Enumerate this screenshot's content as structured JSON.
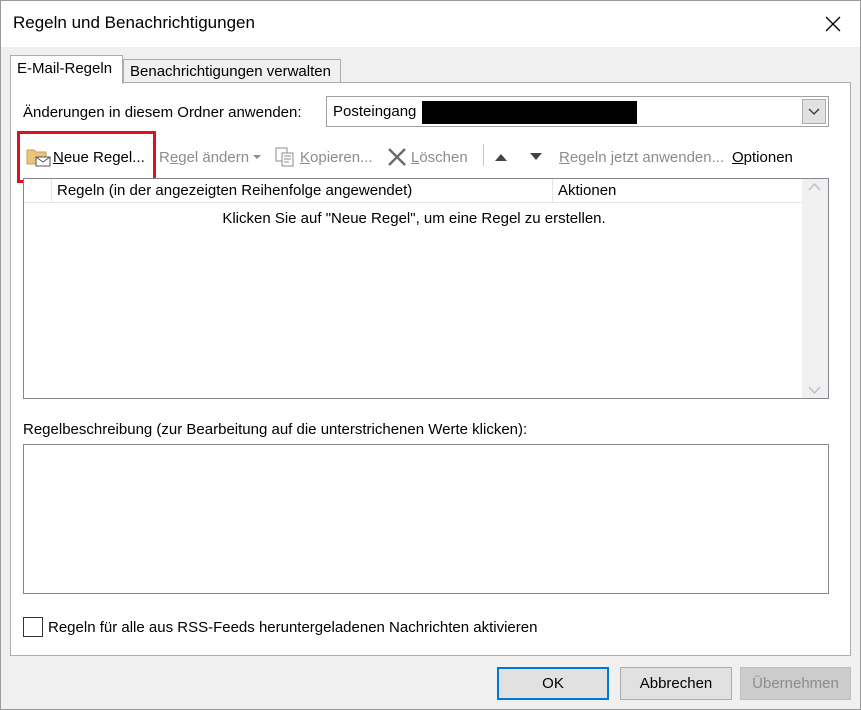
{
  "window": {
    "title": "Regeln und Benachrichtigungen"
  },
  "tabs": [
    {
      "label": "E-Mail-Regeln",
      "active": true
    },
    {
      "label": "Benachrichtigungen verwalten",
      "active": false
    }
  ],
  "folder": {
    "label": "Änderungen in diesem Ordner anwenden:",
    "value": "Posteingang"
  },
  "toolbar": {
    "new_rule": {
      "u": "N",
      "rest": "eue Regel..."
    },
    "change_rule": {
      "pre": "R",
      "u": "e",
      "rest": "gel ändern"
    },
    "copy": {
      "u": "K",
      "rest": "opieren..."
    },
    "delete": {
      "u": "L",
      "rest": "öschen"
    },
    "apply_now": {
      "u": "R",
      "rest": "egeln jetzt anwenden..."
    },
    "options": {
      "u": "O",
      "rest": "ptionen"
    }
  },
  "rules_table": {
    "columns": [
      "Regeln (in der angezeigten Reihenfolge angewendet)",
      "Aktionen"
    ],
    "empty_message": "Klicken Sie auf \"Neue Regel\", um eine Regel zu erstellen."
  },
  "description": {
    "label": "Regelbeschreibung (zur Bearbeitung auf die unterstrichenen Werte klicken):"
  },
  "rss": {
    "label": "Regeln für alle aus RSS-Feeds heruntergeladenen Nachrichten aktivieren",
    "checked": false
  },
  "buttons": {
    "ok": "OK",
    "cancel": "Abbrechen",
    "apply": "Übernehmen"
  },
  "colors": {
    "highlight": "#e0101a",
    "accent": "#0078d7",
    "disabled_text": "#8c8c8c"
  }
}
